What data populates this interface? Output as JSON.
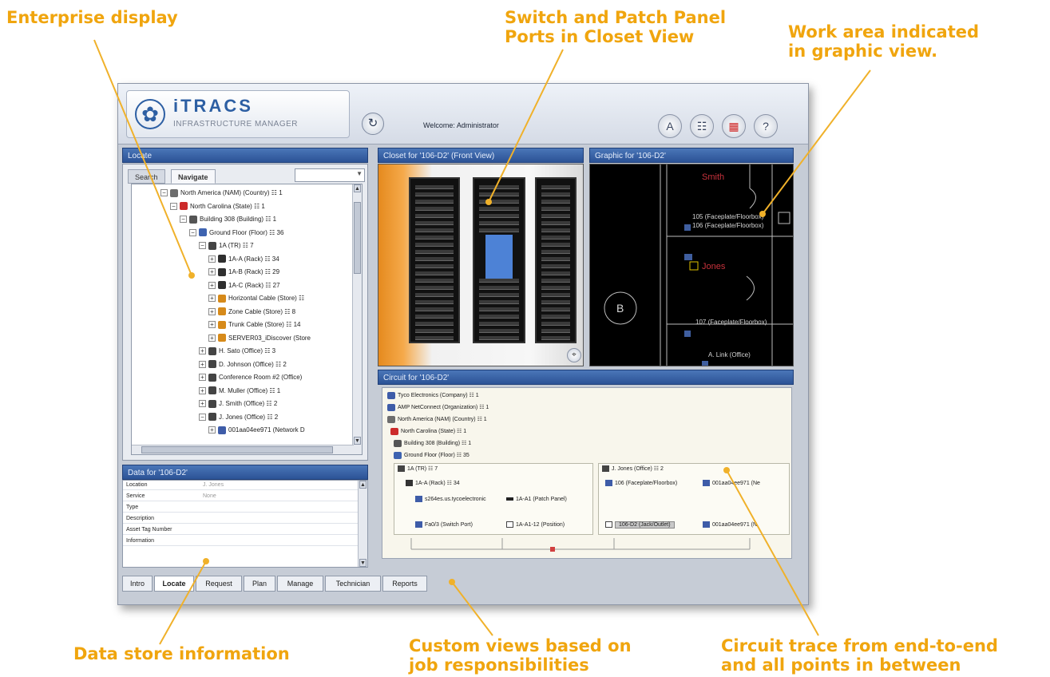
{
  "callouts": {
    "enterprise": "Enterprise display",
    "switch_l1": "Switch and Patch Panel",
    "switch_l2": "Ports in Closet View",
    "work_l1": "Work area indicated",
    "work_l2": "in graphic view.",
    "data_store": "Data store information",
    "custom_l1": "Custom views based on",
    "custom_l2": "job responsibilities",
    "circuit_l1": "Circuit trace from end-to-end",
    "circuit_l2": "and all points in between"
  },
  "header": {
    "logo_title": "iTRACS",
    "logo_subtitle": "INFRASTRUCTURE MANAGER",
    "welcome": "Welcome: Administrator",
    "buttons": [
      "A",
      "?"
    ]
  },
  "locate": {
    "title": "Locate",
    "tabs": [
      "Search",
      "Navigate"
    ],
    "tree": [
      {
        "label": "North America (NAM)  (Country)  ☷ 1",
        "depth": 0,
        "sign": "−",
        "color": "#6d6d6d"
      },
      {
        "label": "North Carolina  (State)  ☷ 1",
        "depth": 1,
        "sign": "−",
        "color": "#cc2b2b"
      },
      {
        "label": "Building 308  (Building)  ☷ 1",
        "depth": 2,
        "sign": "−",
        "color": "#555555"
      },
      {
        "label": "Ground Floor  (Floor)  ☷ 36",
        "depth": 3,
        "sign": "−",
        "color": "#3e63b0"
      },
      {
        "label": "1A  (TR)  ☷ 7",
        "depth": 4,
        "sign": "−",
        "color": "#444444"
      },
      {
        "label": "1A-A  (Rack)  ☷ 34",
        "depth": 5,
        "sign": "+",
        "color": "#2f2f2f"
      },
      {
        "label": "1A-B  (Rack)  ☷ 29",
        "depth": 5,
        "sign": "+",
        "color": "#2f2f2f"
      },
      {
        "label": "1A-C  (Rack)  ☷ 27",
        "depth": 5,
        "sign": "+",
        "color": "#2f2f2f"
      },
      {
        "label": "Horizontal Cable  (Store)  ☷",
        "depth": 5,
        "sign": "+",
        "color": "#d68a1a"
      },
      {
        "label": "Zone Cable  (Store)  ☷ 8",
        "depth": 5,
        "sign": "+",
        "color": "#d68a1a"
      },
      {
        "label": "Trunk Cable  (Store)  ☷ 14",
        "depth": 5,
        "sign": "+",
        "color": "#d68a1a"
      },
      {
        "label": "SERVER03_iDiscover  (Store",
        "depth": 5,
        "sign": "+",
        "color": "#d68a1a"
      },
      {
        "label": "H. Sato  (Office)  ☷ 3",
        "depth": 4,
        "sign": "+",
        "color": "#444444"
      },
      {
        "label": "D. Johnson  (Office)  ☷ 2",
        "depth": 4,
        "sign": "+",
        "color": "#444444"
      },
      {
        "label": "Conference Room #2  (Office)",
        "depth": 4,
        "sign": "+",
        "color": "#444444"
      },
      {
        "label": "M. Muller  (Office)  ☷ 1",
        "depth": 4,
        "sign": "+",
        "color": "#444444"
      },
      {
        "label": "J. Smith  (Office)  ☷ 2",
        "depth": 4,
        "sign": "+",
        "color": "#444444"
      },
      {
        "label": "J. Jones  (Office)  ☷ 2",
        "depth": 4,
        "sign": "−",
        "color": "#444444"
      },
      {
        "label": "001aa04ee971  (Network D",
        "depth": 5,
        "sign": "+",
        "color": "#3e5ca8"
      }
    ]
  },
  "data_panel": {
    "title": "Data for '106-D2'",
    "rows": [
      {
        "key": "Location",
        "value": "J. Jones"
      },
      {
        "key": "Service",
        "value": "None"
      },
      {
        "key": "Type",
        "value": ""
      },
      {
        "key": "Description",
        "value": ""
      },
      {
        "key": "Asset Tag Number",
        "value": ""
      },
      {
        "key": "Information",
        "value": ""
      }
    ]
  },
  "closet": {
    "title": "Closet for '106-D2' (Front View)"
  },
  "graphic": {
    "title": "Graphic for '106-D2'",
    "labels": {
      "smith": "Smith",
      "jones": "Jones",
      "fp105": "105 (Faceplate/Floorbox)",
      "fp106": "106 (Faceplate/Floorbox)",
      "fp107": "107 (Faceplate/Floorbox)",
      "room": "B",
      "link": "A. Link (Office)"
    }
  },
  "circuit": {
    "title": "Circuit for '106-D2'",
    "rows": [
      {
        "label": "Tyco Electronics (Company)   ☷ 1",
        "indent": 0,
        "color": "#3e5ca8"
      },
      {
        "label": "AMP NetConnect (Organization)   ☷ 1",
        "indent": 0,
        "color": "#3e5ca8"
      },
      {
        "label": "North America (NAM) (Country)   ☷ 1",
        "indent": 0,
        "color": "#6d6d6d"
      },
      {
        "label": "North Carolina (State)   ☷ 1",
        "indent": 4,
        "color": "#cc2b2b"
      },
      {
        "label": "Building 308  (Building)   ☷ 1",
        "indent": 8,
        "color": "#555555"
      },
      {
        "label": "Ground Floor (Floor)   ☷ 35",
        "indent": 8,
        "color": "#3e63b0"
      }
    ],
    "left_group": {
      "tr": "1A (TR)   ☷ 7",
      "rack": "1A-A (Rack)   ☷ 34",
      "switch": "s264es.us.tycoelectronic",
      "patch": "1A-A1 (Patch Panel)",
      "port": "Fa0/3 (Switch Port)",
      "position": "1A-A1-12 (Position)"
    },
    "right_group": {
      "office": "J. Jones  (Office)  ☷ 2",
      "faceplate": "106 (Faceplate/Floorbox)",
      "device1": "001aa04ee971 (Ne",
      "jack": "106-D2 (Jack/Outlet)",
      "device2": "001aa04ee971 (N"
    }
  },
  "bottom_tabs": [
    "Intro",
    "Locate",
    "Request",
    "Plan",
    "Manage",
    "Technician",
    "Reports"
  ]
}
